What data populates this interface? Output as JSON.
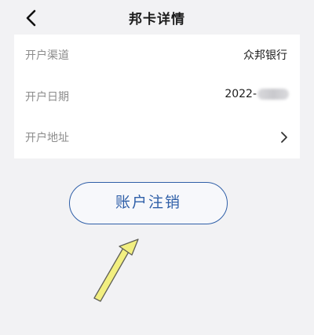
{
  "header": {
    "title": "邦卡详情",
    "back_icon": "chevron-left-icon"
  },
  "card": {
    "rows": [
      {
        "label": "开户渠道",
        "value": "众邦银行"
      },
      {
        "label": "开户日期",
        "value": "2022-",
        "value_masked": true
      },
      {
        "label": "开户地址",
        "value": "",
        "trailing_icon": "chevron-right-icon"
      }
    ]
  },
  "actions": {
    "cancel_account_label": "账户注销"
  },
  "colors": {
    "accent": "#2f5fa8",
    "background": "#f2f2f4",
    "annotation_arrow": "#f2ef80"
  }
}
